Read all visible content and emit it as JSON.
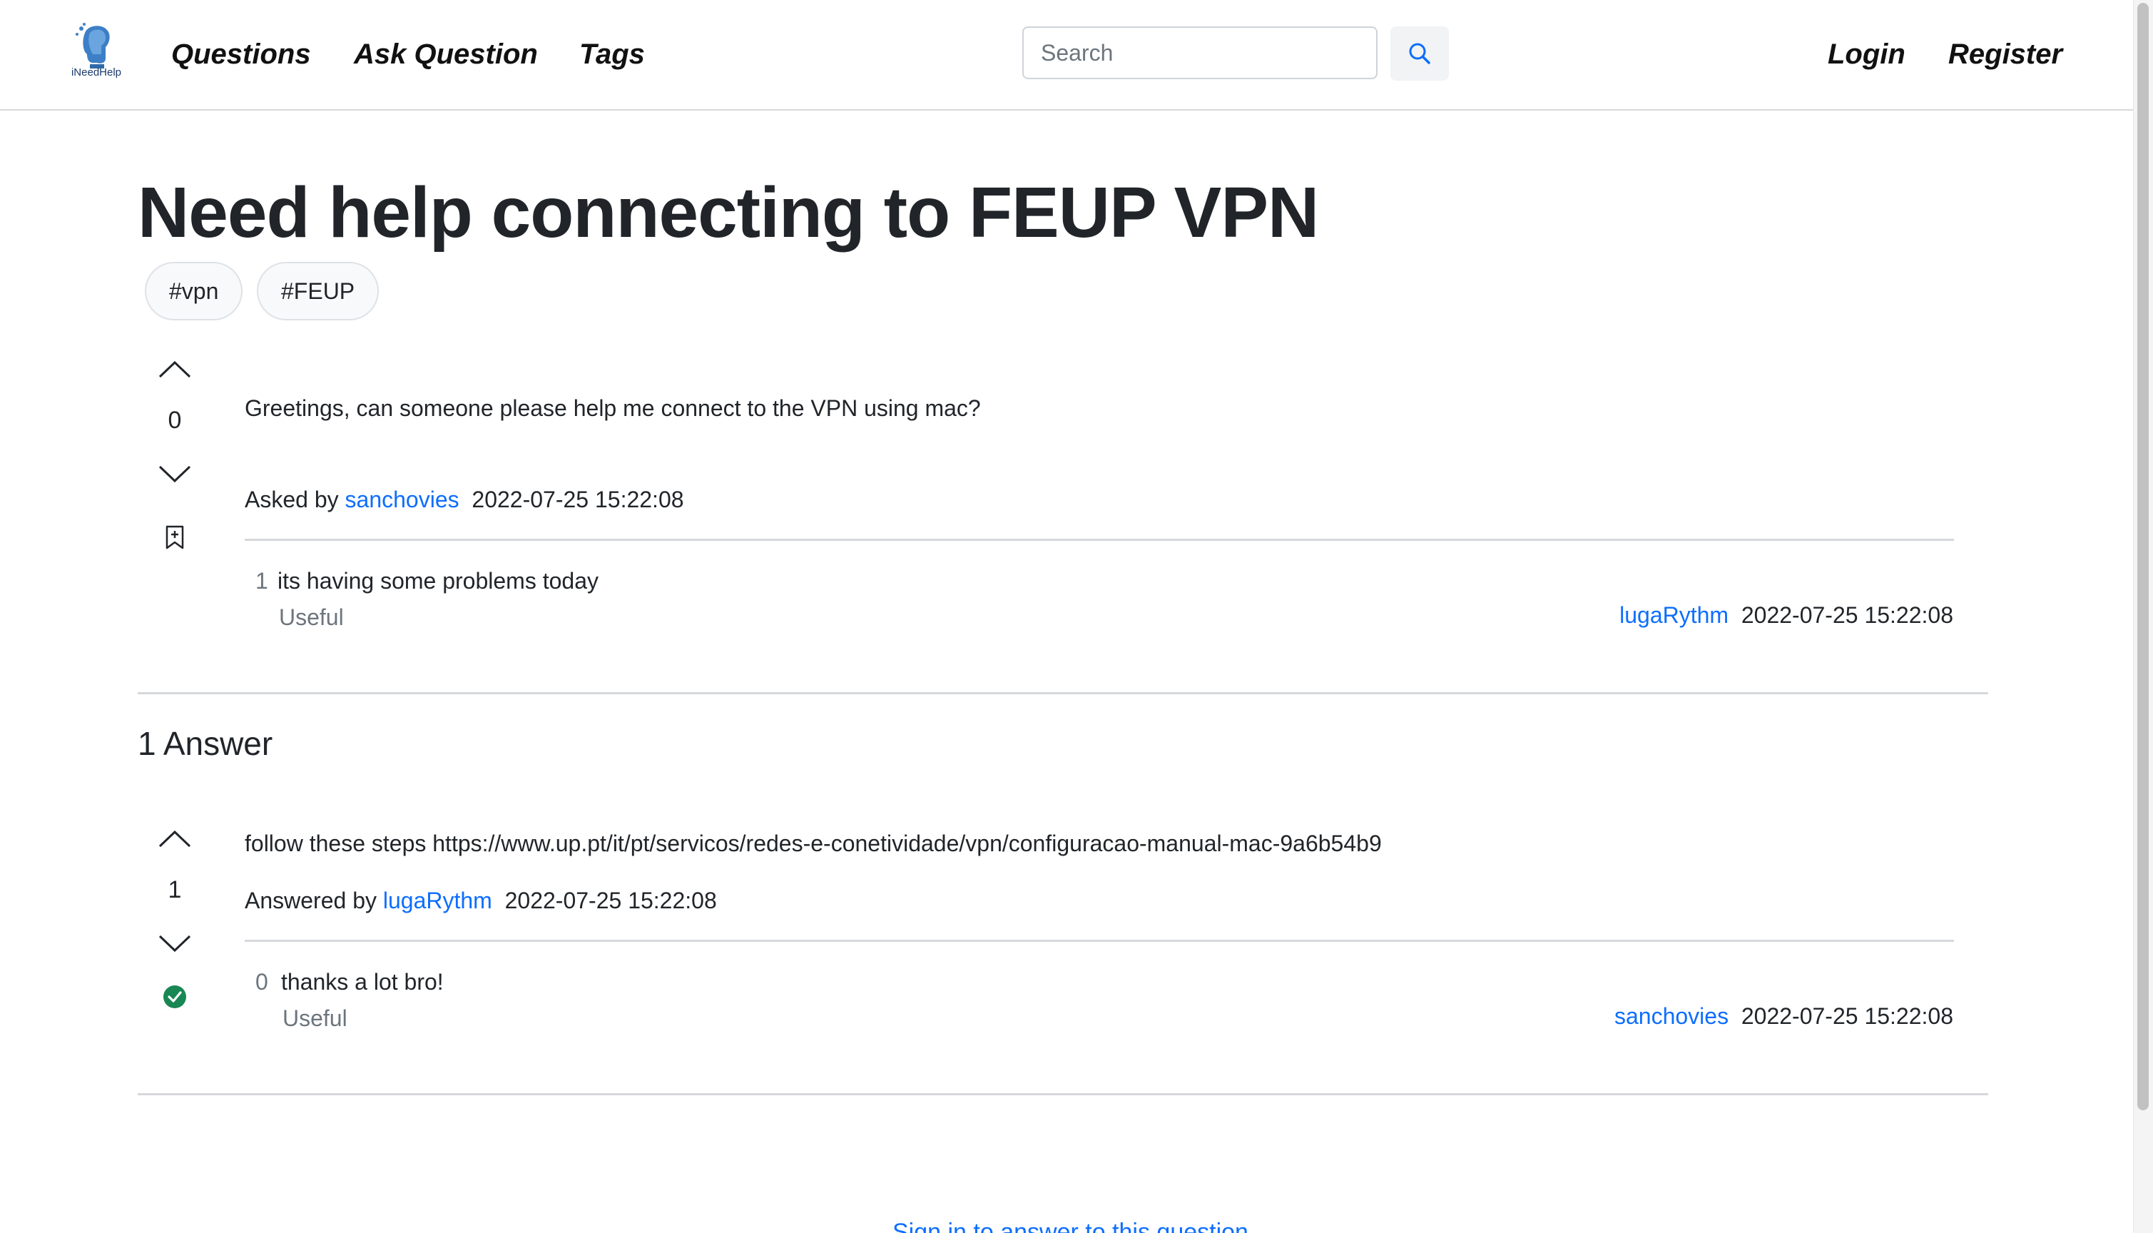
{
  "navbar": {
    "logo_text": "iNeedHelp",
    "links": {
      "questions": "Questions",
      "ask_question": "Ask Question",
      "tags": "Tags",
      "login": "Login",
      "register": "Register"
    },
    "search": {
      "placeholder": "Search",
      "value": ""
    }
  },
  "question": {
    "title": "Need help connecting to FEUP VPN",
    "tags": [
      "#vpn",
      "#FEUP"
    ],
    "votes": "0",
    "body": "Greetings, can someone please help me connect to the VPN using mac?",
    "asked_by_label": "Asked by",
    "author": "sanchovies",
    "timestamp": "2022-07-25 15:22:08",
    "comments": [
      {
        "score": "1",
        "text": "its having some problems today",
        "useful_label": "Useful",
        "author": "lugaRythm",
        "timestamp": "2022-07-25 15:22:08"
      }
    ]
  },
  "answers": {
    "heading": "1 Answer",
    "items": [
      {
        "votes": "1",
        "body": "follow these steps https://www.up.pt/it/pt/servicos/redes-e-conetividade/vpn/configuracao-manual-mac-9a6b54b9",
        "answered_by_label": "Answered by",
        "author": "lugaRythm",
        "timestamp": "2022-07-25 15:22:08",
        "accepted": true,
        "comments": [
          {
            "score": "0",
            "text": "thanks a lot bro!",
            "useful_label": "Useful",
            "author": "sanchovies",
            "timestamp": "2022-07-25 15:22:08"
          }
        ]
      }
    ]
  },
  "footer": {
    "signin_text": "Sign in to answer to this question"
  },
  "colors": {
    "link": "#0d6efd",
    "accepted": "#198754",
    "text": "#212529",
    "muted": "#6c757d"
  }
}
